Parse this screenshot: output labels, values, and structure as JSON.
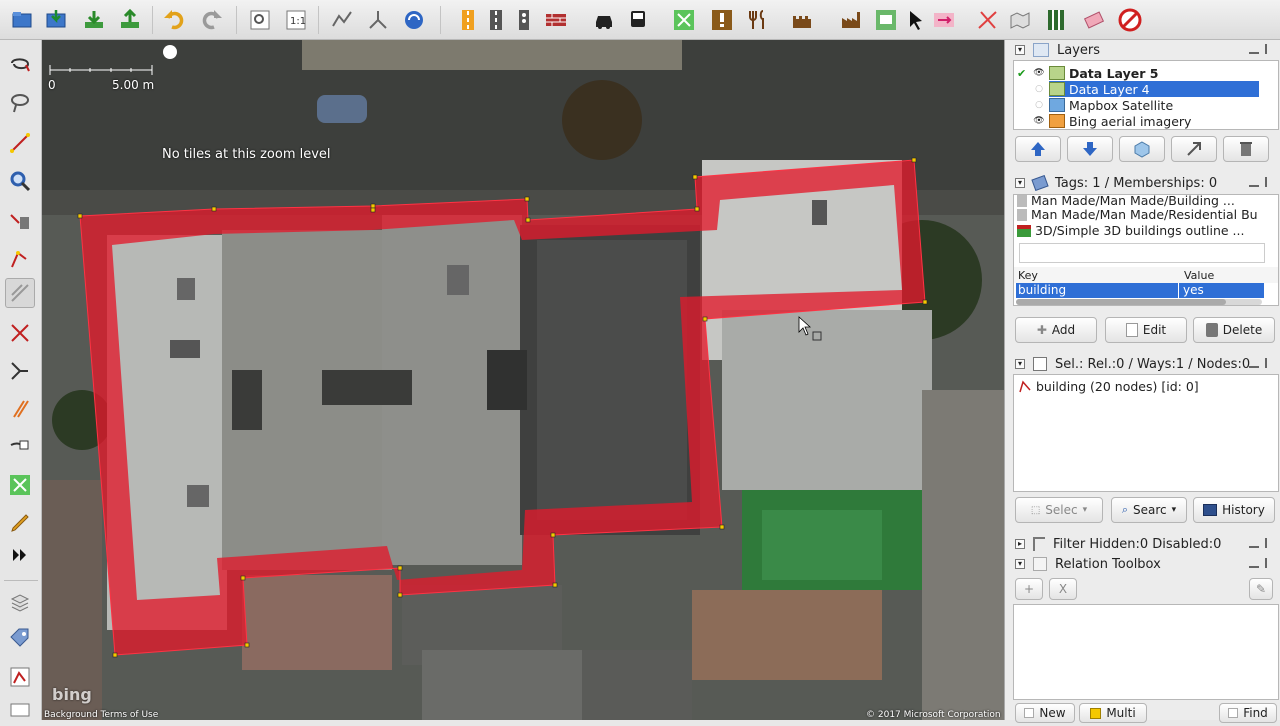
{
  "map": {
    "scale_zero": "0",
    "scale_label": "5.00 m",
    "no_tiles_message": "No tiles at this zoom level",
    "bing_logo": "bing",
    "footer_left": "Background Terms of Use",
    "footer_right": "© 2017 Microsoft Corporation"
  },
  "layers": {
    "title": "Layers",
    "items": [
      {
        "label": "Data Layer 5",
        "bold": true,
        "selected": false,
        "active": true
      },
      {
        "label": "Data Layer 4",
        "bold": false,
        "selected": true,
        "active": false
      },
      {
        "label": "Mapbox Satellite",
        "bold": false,
        "selected": false,
        "active": false
      },
      {
        "label": "Bing aerial imagery",
        "bold": false,
        "selected": false,
        "active": false
      }
    ]
  },
  "tags": {
    "title": "Tags: 1 / Memberships: 0",
    "presets": [
      "Man Made/Man Made/Building ...",
      "Man Made/Man Made/Residential Bu",
      "3D/Simple 3D buildings outline ..."
    ],
    "col_key": "Key",
    "col_value": "Value",
    "rows": [
      {
        "key": "building",
        "value": "yes"
      }
    ],
    "add_label": "Add",
    "edit_label": "Edit",
    "delete_label": "Delete"
  },
  "selection": {
    "title": "Sel.: Rel.:0 / Ways:1 / Nodes:0",
    "items": [
      "building (20 nodes) [id: 0]"
    ],
    "select_label": "Selec",
    "search_label": "Searc",
    "history_label": "History"
  },
  "filter": {
    "title": "Filter Hidden:0 Disabled:0"
  },
  "relation": {
    "title": "Relation Toolbox",
    "add_symbol": "+",
    "remove_symbol": "X",
    "new_label": "New",
    "multi_label": "Multi",
    "find_label": "Find"
  },
  "colors": {
    "polygon_fill": "#e11a2b",
    "node_color": "#f5c800",
    "selection_blue": "#2f6fd6"
  }
}
